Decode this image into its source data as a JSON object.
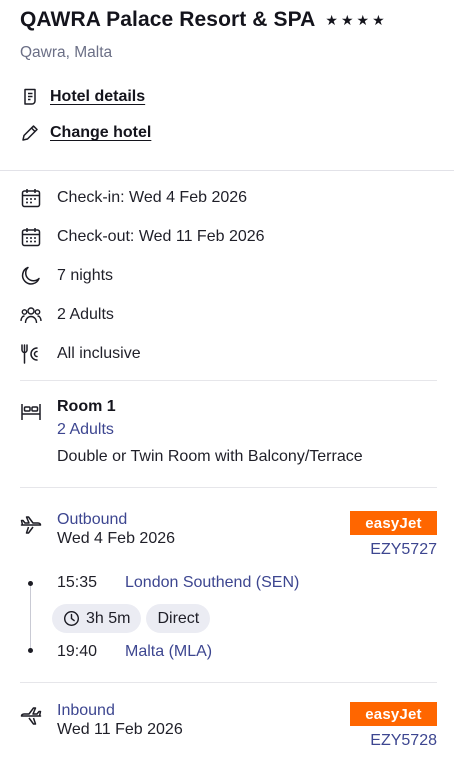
{
  "hotel": {
    "name": "QAWRA Palace Resort & SPA",
    "stars": [
      "★",
      "★",
      "★",
      "★"
    ],
    "location": "Qawra, Malta"
  },
  "links": {
    "hotel_details": "Hotel details",
    "change_hotel": "Change hotel"
  },
  "stay": {
    "check_in": "Check-in: Wed 4 Feb 2026",
    "check_out": "Check-out: Wed 11 Feb 2026",
    "nights": "7 nights",
    "guests": "2 Adults",
    "board": "All inclusive"
  },
  "room": {
    "title": "Room 1",
    "adults": "2 Adults",
    "type": "Double or Twin Room with Balcony/Terrace"
  },
  "outbound": {
    "label": "Outbound",
    "date": "Wed 4 Feb 2026",
    "airline": "easyJet",
    "flight_number": "EZY5727",
    "departure_time": "15:35",
    "departure_place": "London Southend (SEN)",
    "duration": "3h 5m",
    "stops": "Direct",
    "arrival_time": "19:40",
    "arrival_place": "Malta (MLA)"
  },
  "inbound": {
    "label": "Inbound",
    "date": "Wed 11 Feb 2026",
    "airline": "easyJet",
    "flight_number": "EZY5728"
  },
  "colors": {
    "accent_text": "#3d4690",
    "airline_brand": "#ff6600",
    "chip_bg": "#ebecf3"
  },
  "icons": {
    "hotel_details": "document-icon",
    "change_hotel": "pencil-icon",
    "check_in": "calendar-icon",
    "check_out": "calendar-icon",
    "nights": "moon-icon",
    "guests": "people-icon",
    "board": "cutlery-icon",
    "room": "bed-icon",
    "outbound": "plane-takeoff-icon",
    "inbound": "plane-landing-icon",
    "duration": "clock-icon"
  }
}
